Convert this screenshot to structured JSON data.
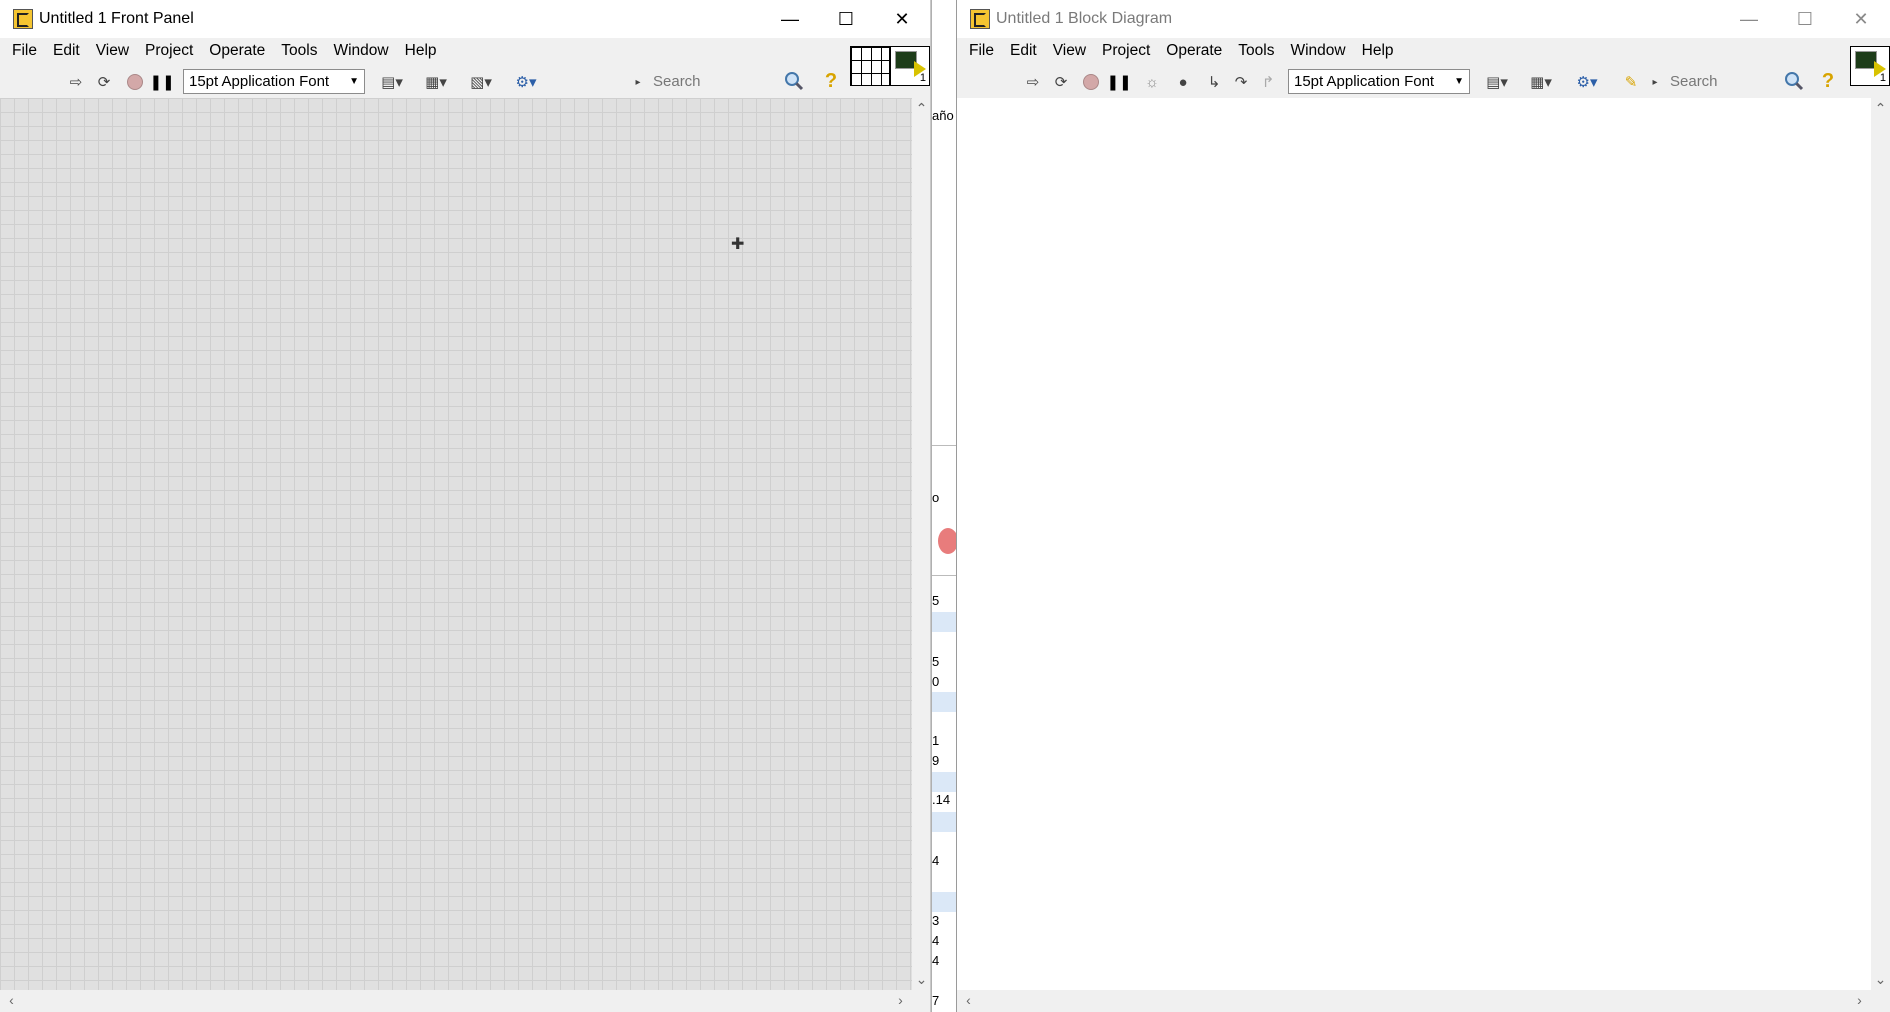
{
  "front_panel": {
    "title": "Untitled 1 Front Panel",
    "menu": [
      "File",
      "Edit",
      "View",
      "Project",
      "Operate",
      "Tools",
      "Window",
      "Help"
    ],
    "font_select": "15pt Application Font",
    "search_placeholder": "Search",
    "vi_icon_number": "1"
  },
  "block_diagram": {
    "title": "Untitled 1 Block Diagram",
    "menu": [
      "File",
      "Edit",
      "View",
      "Project",
      "Operate",
      "Tools",
      "Window",
      "Help"
    ],
    "font_select": "15pt Application Font",
    "search_placeholder": "Search",
    "vi_icon_number": "1"
  },
  "background_window": {
    "fragments": [
      "año",
      "o",
      "5",
      "5",
      "0",
      "1",
      "9",
      ".14",
      "4",
      "3",
      "4",
      "4",
      "7"
    ]
  },
  "colors": {
    "panel_grid_bg": "#e0e0e0",
    "diagram_bg": "#ffffff",
    "row_highlight": "#dbe8f7"
  }
}
